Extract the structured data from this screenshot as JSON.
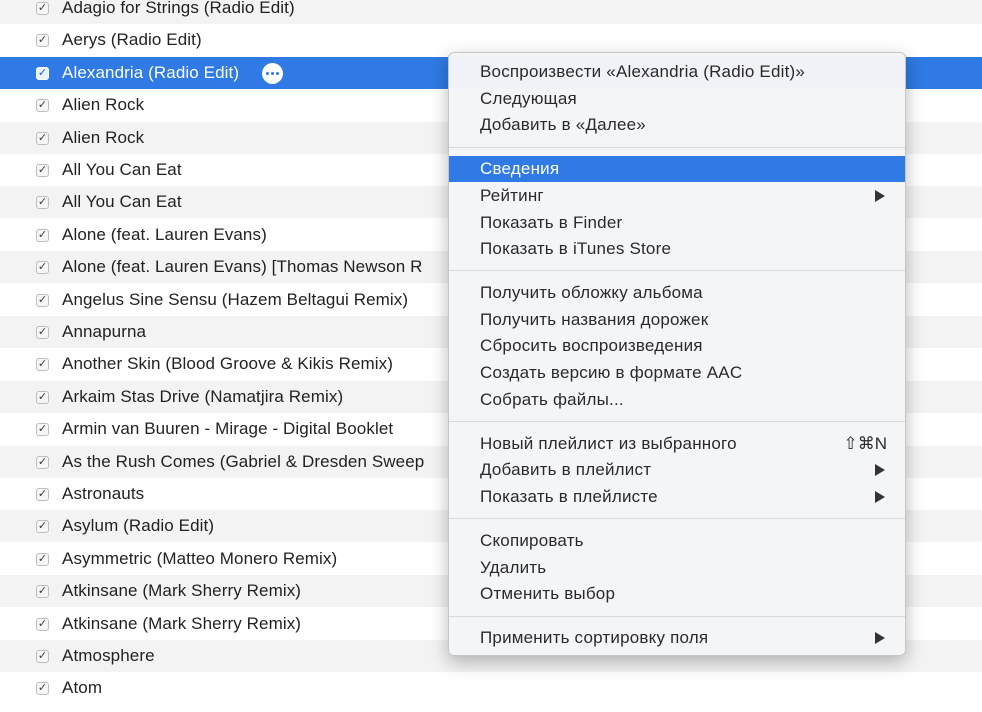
{
  "tracks": [
    {
      "title": "Adagio for Strings (Radio Edit)",
      "checked": true
    },
    {
      "title": "Aerys (Radio Edit)",
      "checked": true
    },
    {
      "title": "Alexandria (Radio Edit)",
      "checked": true,
      "selected": true
    },
    {
      "title": "Alien Rock",
      "checked": true
    },
    {
      "title": "Alien Rock",
      "checked": true
    },
    {
      "title": "All You Can Eat",
      "checked": true
    },
    {
      "title": "All You Can Eat",
      "checked": true
    },
    {
      "title": "Alone (feat. Lauren Evans)",
      "checked": true
    },
    {
      "title": "Alone (feat. Lauren Evans) [Thomas Newson R",
      "checked": true
    },
    {
      "title": "Angelus Sine Sensu (Hazem Beltagui Remix)",
      "checked": true
    },
    {
      "title": "Annapurna",
      "checked": true
    },
    {
      "title": "Another Skin (Blood Groove & Kikis Remix)",
      "checked": true
    },
    {
      "title": "Arkaim Stas Drive (Namatjira Remix)",
      "checked": true
    },
    {
      "title": "Armin van Buuren - Mirage - Digital Booklet",
      "checked": true
    },
    {
      "title": "As the Rush Comes (Gabriel & Dresden Sweep",
      "checked": true
    },
    {
      "title": "Astronauts",
      "checked": true
    },
    {
      "title": "Asylum (Radio Edit)",
      "checked": true
    },
    {
      "title": "Asymmetric (Matteo Monero Remix)",
      "checked": true
    },
    {
      "title": "Atkinsane (Mark Sherry Remix)",
      "checked": true
    },
    {
      "title": "Atkinsane (Mark Sherry Remix)",
      "checked": true
    },
    {
      "title": "Atmosphere",
      "checked": true
    },
    {
      "title": "Atom",
      "checked": true
    }
  ],
  "check_glyph": "✓",
  "context_menu": {
    "groups": [
      [
        {
          "label": "Воспроизвести «Alexandria (Radio Edit)»"
        },
        {
          "label": "Следующая"
        },
        {
          "label": "Добавить в «Далее»"
        }
      ],
      [
        {
          "label": "Сведения",
          "highlighted": true
        },
        {
          "label": "Рейтинг",
          "submenu": true
        },
        {
          "label": "Показать в Finder"
        },
        {
          "label": "Показать в iTunes Store"
        }
      ],
      [
        {
          "label": "Получить обложку альбома"
        },
        {
          "label": "Получить названия дорожек"
        },
        {
          "label": "Сбросить воспроизведения"
        },
        {
          "label": "Создать версию в формате AAC"
        },
        {
          "label": "Собрать файлы..."
        }
      ],
      [
        {
          "label": "Новый плейлист из выбранного",
          "shortcut": "⇧⌘N"
        },
        {
          "label": "Добавить в плейлист",
          "submenu": true
        },
        {
          "label": "Показать в плейлисте",
          "submenu": true
        }
      ],
      [
        {
          "label": "Скопировать"
        },
        {
          "label": "Удалить"
        },
        {
          "label": "Отменить выбор"
        }
      ],
      [
        {
          "label": "Применить сортировку поля",
          "submenu": true
        }
      ]
    ]
  },
  "colors": {
    "selection": "#2f7ae4",
    "row_alt": "#f3f3f3"
  },
  "icons": {
    "row_action": "more-options-icon",
    "submenu": "submenu-arrow-icon",
    "check": "checkmark-icon"
  }
}
